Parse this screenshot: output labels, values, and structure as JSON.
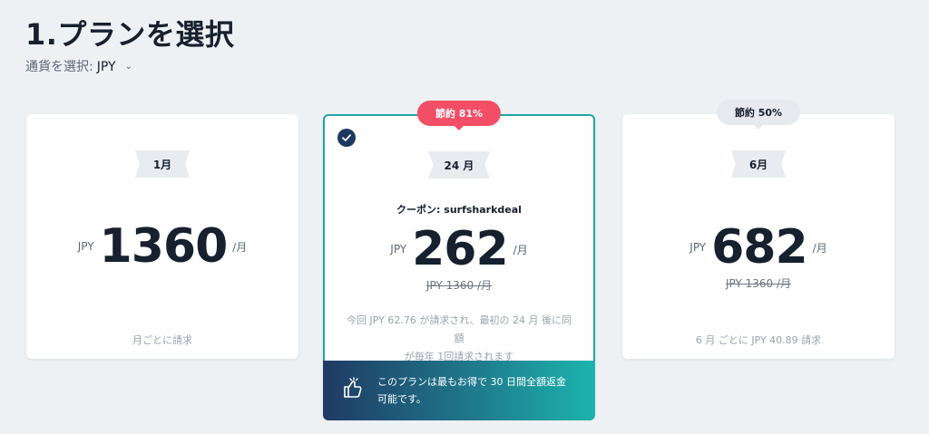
{
  "header": {
    "title": "1.プランを選択",
    "currency_label": "通貨を選択:",
    "currency_value": "JPY"
  },
  "plans": [
    {
      "period": "1月",
      "currency": "JPY",
      "price": "1360",
      "per": "/月",
      "billing_note": "月ごとに請求"
    },
    {
      "period": "24 月",
      "save_badge": "節約 81%",
      "coupon": "クーポン: surfsharkdeal",
      "currency": "JPY",
      "price": "262",
      "per": "/月",
      "original_price": "JPY 1360 /月",
      "billing_note_line1": "今回 JPY 62.76 が請求され、最初の 24 月 後に同額",
      "billing_note_line2": "が毎年 1回請求されます",
      "promo_line1": "このプランは最もお得で 30 日間全額返金",
      "promo_line2": "可能です。",
      "selected": true
    },
    {
      "period": "6月",
      "save_badge": "節約 50%",
      "currency": "JPY",
      "price": "682",
      "per": "/月",
      "original_price": "JPY 1360 /月",
      "billing_note": "6 月 ごとに JPY 40.89 請求"
    }
  ],
  "colors": {
    "accent_teal": "#1fa5a6",
    "badge_red": "#f24f66",
    "dark_navy": "#1d3960"
  }
}
